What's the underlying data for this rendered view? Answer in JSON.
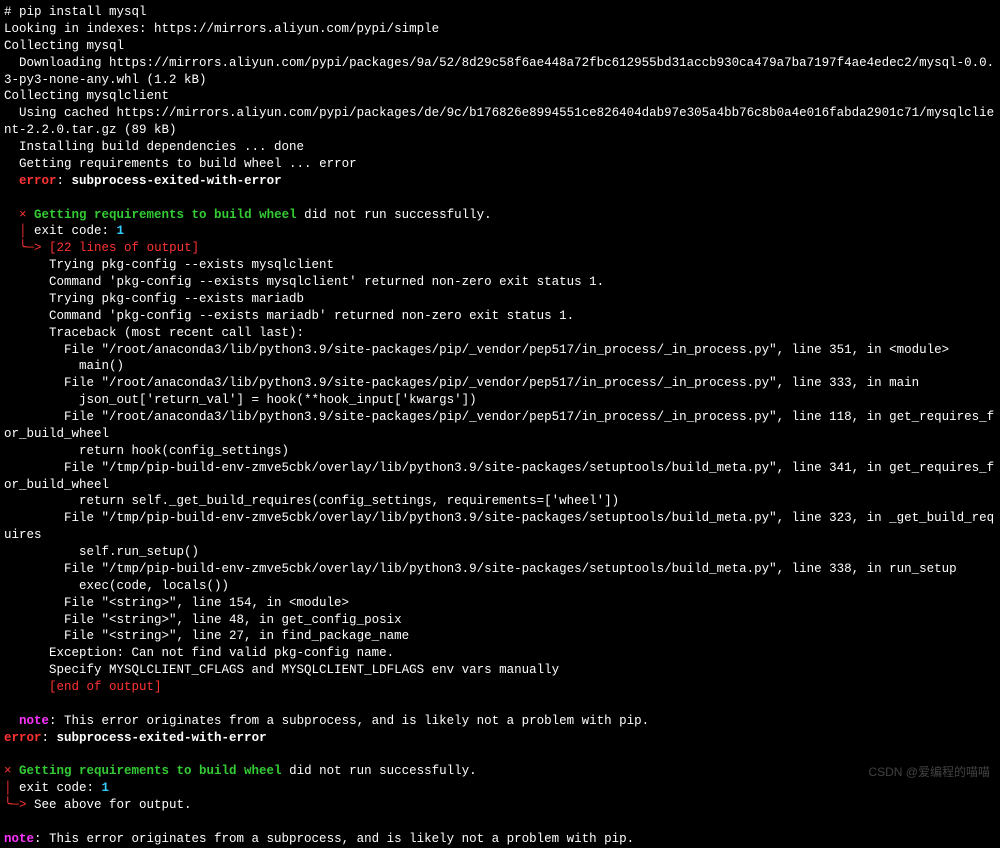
{
  "terminal": {
    "command": "# pip install mysql",
    "line1": "Looking in indexes: https://mirrors.aliyun.com/pypi/simple",
    "line2": "Collecting mysql",
    "line3": "  Downloading https://mirrors.aliyun.com/pypi/packages/9a/52/8d29c58f6ae448a72fbc612955bd31accb930ca479a7ba7197f4ae4edec2/mysql-0.0.3-py3-none-any.whl (1.2 kB)",
    "line4": "Collecting mysqlclient",
    "line5": "  Using cached https://mirrors.aliyun.com/pypi/packages/de/9c/b176826e8994551ce826404dab97e305a4bb76c8b0a4e016fabda2901c71/mysqlclient-2.2.0.tar.gz (89 kB)",
    "line6": "  Installing build dependencies ... done",
    "line7": "  Getting requirements to build wheel ... error",
    "error_label": "  error",
    "error_msg": "subprocess-exited-with-error",
    "block1_cross": "  ×",
    "block1_title": " Getting requirements to build wheel",
    "block1_title_end": " did not run successfully.",
    "block1_pipe": "  │",
    "block1_exit": " exit code: ",
    "block1_exitcode": "1",
    "block1_arrow": "  ╰─>",
    "block1_lines": " [22 lines of output]",
    "tb1": "      Trying pkg-config --exists mysqlclient",
    "tb2": "      Command 'pkg-config --exists mysqlclient' returned non-zero exit status 1.",
    "tb3": "      Trying pkg-config --exists mariadb",
    "tb4": "      Command 'pkg-config --exists mariadb' returned non-zero exit status 1.",
    "tb5": "      Traceback (most recent call last):",
    "tb6": "        File \"/root/anaconda3/lib/python3.9/site-packages/pip/_vendor/pep517/in_process/_in_process.py\", line 351, in <module>",
    "tb7": "          main()",
    "tb8": "        File \"/root/anaconda3/lib/python3.9/site-packages/pip/_vendor/pep517/in_process/_in_process.py\", line 333, in main",
    "tb9": "          json_out['return_val'] = hook(**hook_input['kwargs'])",
    "tb10": "        File \"/root/anaconda3/lib/python3.9/site-packages/pip/_vendor/pep517/in_process/_in_process.py\", line 118, in get_requires_for_build_wheel",
    "tb11": "          return hook(config_settings)",
    "tb12": "        File \"/tmp/pip-build-env-zmve5cbk/overlay/lib/python3.9/site-packages/setuptools/build_meta.py\", line 341, in get_requires_for_build_wheel",
    "tb13": "          return self._get_build_requires(config_settings, requirements=['wheel'])",
    "tb14": "        File \"/tmp/pip-build-env-zmve5cbk/overlay/lib/python3.9/site-packages/setuptools/build_meta.py\", line 323, in _get_build_requires",
    "tb15": "          self.run_setup()",
    "tb16": "        File \"/tmp/pip-build-env-zmve5cbk/overlay/lib/python3.9/site-packages/setuptools/build_meta.py\", line 338, in run_setup",
    "tb17": "          exec(code, locals())",
    "tb18": "        File \"<string>\", line 154, in <module>",
    "tb19": "        File \"<string>\", line 48, in get_config_posix",
    "tb20": "        File \"<string>\", line 27, in find_package_name",
    "tb21": "      Exception: Can not find valid pkg-config name.",
    "tb22": "      Specify MYSQLCLIENT_CFLAGS and MYSQLCLIENT_LDFLAGS env vars manually",
    "end_output": "      [end of output]",
    "note_label": "  note",
    "note_text": ": This error originates from a subprocess, and is likely not a problem with pip.",
    "error2_label": "error",
    "error2_msg": "subprocess-exited-with-error",
    "block2_cross": "×",
    "block2_title": " Getting requirements to build wheel",
    "block2_title_end": " did not run successfully.",
    "block2_pipe": "│",
    "block2_exit": " exit code: ",
    "block2_exitcode": "1",
    "block2_arrow": "╰─>",
    "block2_see": " See above for output.",
    "note2_label": "note",
    "note2_text": ": This error originates from a subprocess, and is likely not a problem with pip.",
    "watermark": "CSDN @爱编程的喵喵"
  }
}
